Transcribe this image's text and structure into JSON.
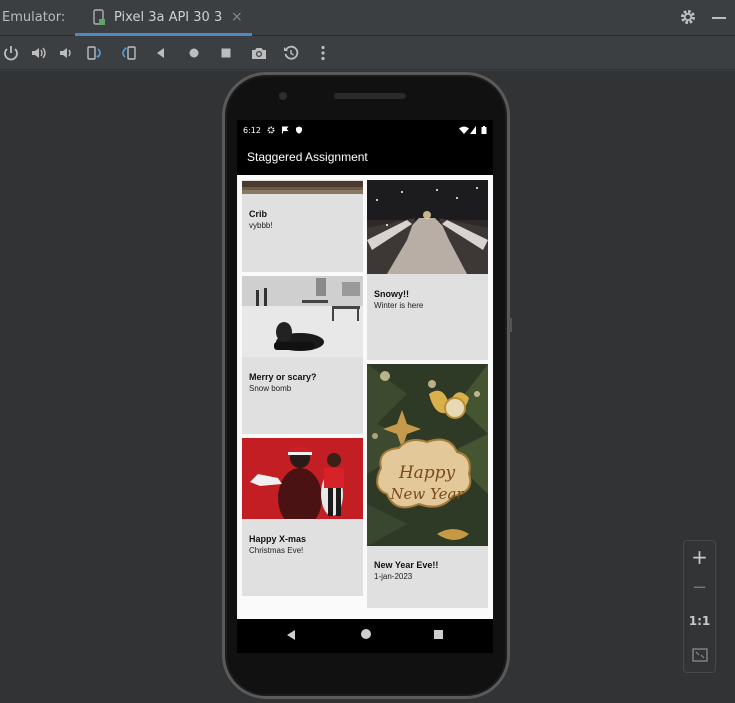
{
  "window": {
    "emulator_label": "Emulator:",
    "tab_title": "Pixel 3a API 30 3",
    "tab_close": "×"
  },
  "toolbar": {
    "buttons": [
      "power-icon",
      "volume-up-icon",
      "volume-down-icon",
      "rotate-left-icon",
      "rotate-right-icon",
      "back-icon",
      "home-icon",
      "overview-icon",
      "camera-icon",
      "snapshot-icon",
      "more-icon"
    ]
  },
  "status_bar": {
    "time": "6:12"
  },
  "app": {
    "title": "Staggered Assignment",
    "cards": [
      {
        "title": "Crib",
        "subtitle": "vybbb!"
      },
      {
        "title": "Snowy!!",
        "subtitle": "Winter is here"
      },
      {
        "title": "Merry or scary?",
        "subtitle": "Snow bomb"
      },
      {
        "title": "New Year Eve!!",
        "subtitle": "1-jan-2023",
        "image_text_1": "Happy",
        "image_text_2": "New Year"
      },
      {
        "title": "Happy X-mas",
        "subtitle": "Christmas Eve!"
      }
    ]
  },
  "zoom": {
    "plus": "+",
    "minus": "−",
    "ratio": "1:1"
  },
  "colors": {
    "ide_bg": "#3c3f41",
    "canvas_bg": "#313335",
    "tab_accent": "#4a88c7",
    "card_bg": "#e0e0e0"
  }
}
